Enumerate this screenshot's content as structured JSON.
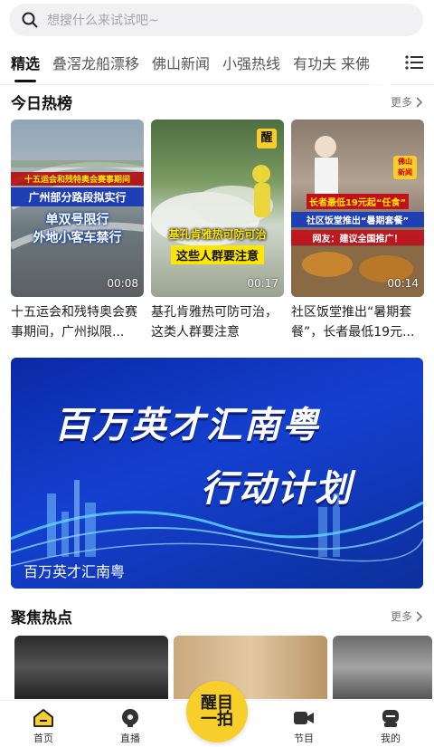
{
  "search": {
    "placeholder": "想搜什么来试试吧~"
  },
  "tabs": [
    "精选",
    "叠滘龙船漂移",
    "佛山新闻",
    "小强热线",
    "有功夫 来佛"
  ],
  "hot": {
    "title": "今日热榜",
    "more": "更多",
    "cards": [
      {
        "duration": "00:08",
        "caption": "十五运会和残特奥会赛事期间，广州拟限...",
        "overlay": [
          "十五运会和残特奥会赛事期间",
          "广州部分路段拟实行",
          "单双号限行",
          "外地小客车禁行"
        ]
      },
      {
        "duration": "00:17",
        "caption": "基孔肯雅热可防可治，这类人群要注意",
        "overlay": [
          "基孔肯雅热可防可治",
          "这些人群要注意"
        ]
      },
      {
        "duration": "00:14",
        "caption": "社区饭堂推出“暑期套餐”，长者最低19元...",
        "overlay": [
          "长者最低19元起“任食”",
          "社区饭堂推出“暑期套餐”",
          "网友：建议全国推广！"
        ]
      }
    ]
  },
  "banner": {
    "line1": "百万英才汇南粤",
    "line2": "行动计划",
    "caption": "百万英才汇南粤"
  },
  "focus": {
    "title": "聚焦热点",
    "more": "更多"
  },
  "nav": {
    "home": "首页",
    "live": "直播",
    "center1": "醒目",
    "center2": "一拍",
    "programs": "节目",
    "mine": "我的"
  },
  "colors": {
    "accent": "#f8cf2a",
    "banner": "#1440d0"
  }
}
